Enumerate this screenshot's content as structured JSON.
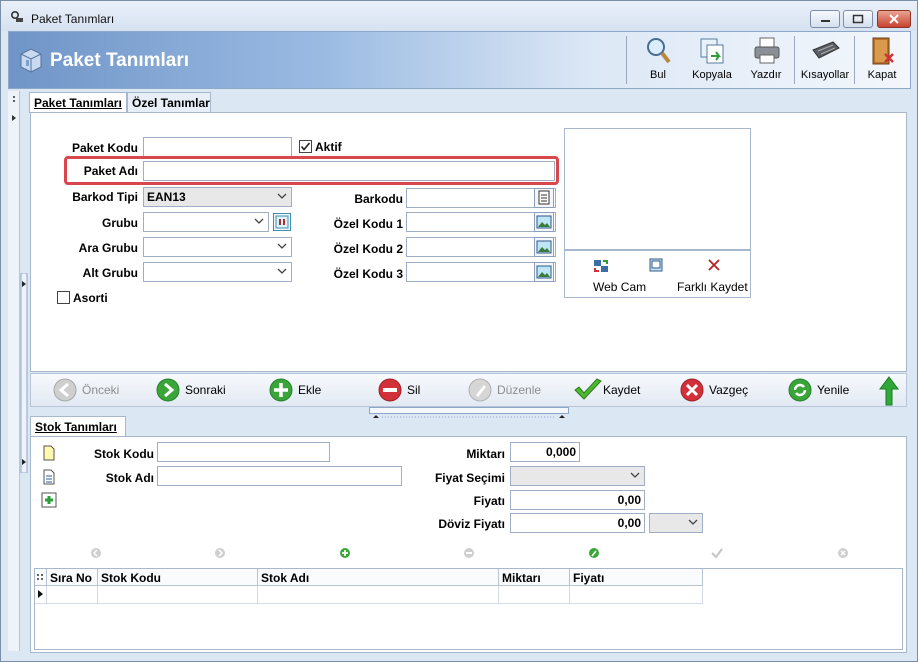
{
  "window": {
    "title": "Paket Tanımları"
  },
  "header": {
    "title": "Paket Tanımları",
    "toolbar": [
      "Bul",
      "Kopyala",
      "Yazdır",
      "Kısayollar",
      "Kapat"
    ]
  },
  "tabs_top": [
    "Paket Tanımları",
    "Özel Tanımlar"
  ],
  "form": {
    "paket_kodu_label": "Paket Kodu",
    "paket_kodu_value": "",
    "aktif_label": "Aktif",
    "aktif_checked": true,
    "paket_adi_label": "Paket Adı",
    "paket_adi_value": "",
    "barkod_tipi_label": "Barkod Tipi",
    "barkod_tipi_value": "EAN13",
    "barkodu_label": "Barkodu",
    "grubu_label": "Grubu",
    "ara_grubu_label": "Ara Grubu",
    "alt_grubu_label": "Alt Grubu",
    "ozel_kodu_1_label": "Özel Kodu 1",
    "ozel_kodu_2_label": "Özel Kodu 2",
    "ozel_kodu_3_label": "Özel Kodu 3",
    "asorti_label": "Asorti"
  },
  "photo": {
    "webcam_label": "Web Cam",
    "save_as_label": "Farklı Kaydet"
  },
  "nav": {
    "onceki": "Önceki",
    "sonraki": "Sonraki",
    "ekle": "Ekle",
    "sil": "Sil",
    "duzenle": "Düzenle",
    "kaydet": "Kaydet",
    "vazgec": "Vazgeç",
    "yenile": "Yenile"
  },
  "tabs_bottom": [
    "Stok Tanımları"
  ],
  "stock": {
    "stok_kodu_label": "Stok Kodu",
    "stok_adi_label": "Stok Adı",
    "miktari_label": "Miktarı",
    "miktari_value": "0,000",
    "fiyat_secimi_label": "Fiyat Seçimi",
    "fiyati_label": "Fiyatı",
    "fiyati_value": "0,00",
    "doviz_fiyati_label": "Döviz Fiyatı",
    "doviz_fiyati_value": "0,00"
  },
  "grid": {
    "columns": [
      "Sıra No",
      "Stok Kodu",
      "Stok Adı",
      "Miktarı",
      "Fiyatı"
    ]
  },
  "colors": {
    "accent": "#6f95c7",
    "highlight": "#d9474e",
    "go": "#3aa63a",
    "stop": "#d2313a"
  }
}
